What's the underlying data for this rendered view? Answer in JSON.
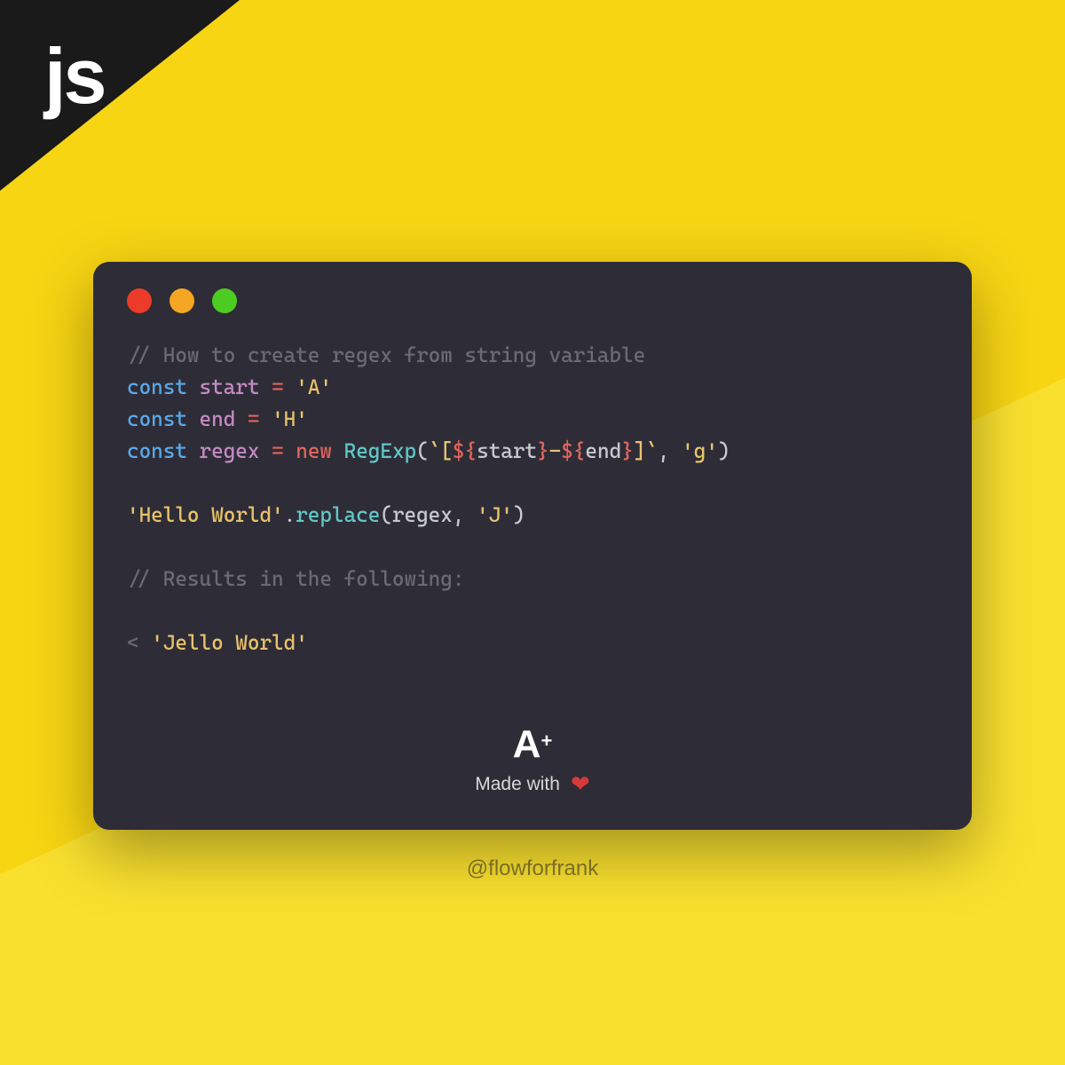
{
  "corner": {
    "label": "js"
  },
  "code": {
    "comment1": "// How to create regex from string variable",
    "line2": {
      "kw": "const",
      "var": "start",
      "eq": "=",
      "str": "'A'"
    },
    "line3": {
      "kw": "const",
      "var": "end",
      "eq": "=",
      "str": "'H'"
    },
    "line4": {
      "kw": "const",
      "var": "regex",
      "eq": "=",
      "new": "new",
      "cls": "RegExp",
      "lparen": "(",
      "tick1": "`",
      "bracket1": "[",
      "dollar1": "${",
      "interp1": "start",
      "brace1": "}",
      "dash": "-",
      "dollar2": "${",
      "interp2": "end",
      "brace2": "}",
      "bracket2": "]",
      "tick2": "`",
      "comma": ", ",
      "flag": "'g'",
      "rparen": ")"
    },
    "line6": {
      "str": "'Hello World'",
      "dot": ".",
      "method": "replace",
      "lparen": "(",
      "arg1": "regex",
      "comma": ", ",
      "arg2": "'J'",
      "rparen": ")"
    },
    "comment2": "// Results in the following:",
    "line10": {
      "arrow": "<",
      "result": "'Jello World'"
    }
  },
  "footer": {
    "grade_a": "A",
    "grade_plus": "+",
    "made_with": "Made with",
    "heart": "❤"
  },
  "handle": "@flowforfrank"
}
